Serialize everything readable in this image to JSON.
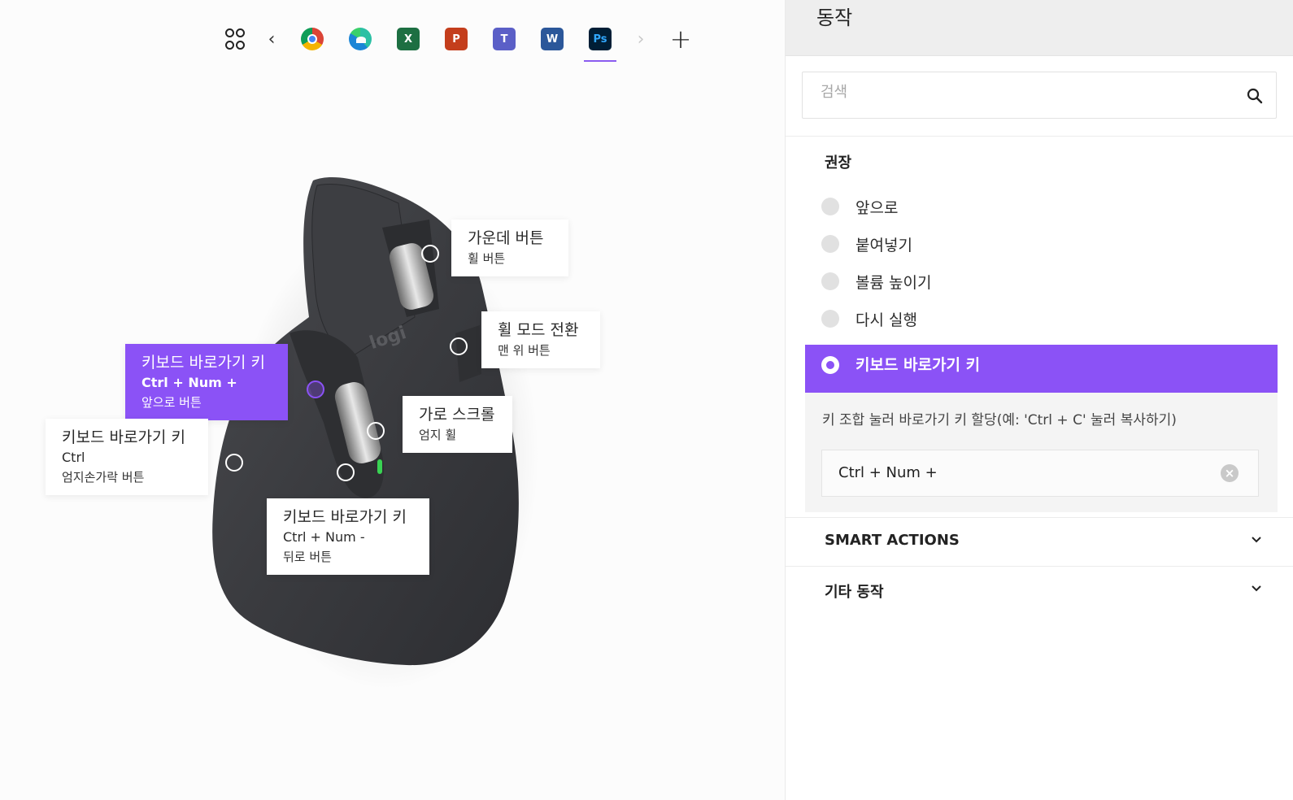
{
  "appbar": {
    "apps": [
      {
        "name": "Chrome"
      },
      {
        "name": "Edge"
      },
      {
        "name": "Excel",
        "glyph": "X",
        "color": "#1d6f42"
      },
      {
        "name": "PowerPoint",
        "glyph": "P",
        "color": "#c43e1c"
      },
      {
        "name": "Teams",
        "glyph": "T",
        "color": "#5b5fc7"
      },
      {
        "name": "Word",
        "glyph": "W",
        "color": "#2b579a"
      },
      {
        "name": "Photoshop",
        "glyph": "Ps",
        "color": "#001e36",
        "active": true
      }
    ],
    "icons": [
      "all-apps-icon",
      "chevron-left-icon",
      "chevron-right-icon",
      "plus-icon"
    ]
  },
  "callouts": {
    "middle": {
      "title": "가운데 버튼",
      "sub": "휠 버튼"
    },
    "wheelmode": {
      "title": "휠 모드 전환",
      "sub": "맨 위 버튼"
    },
    "forward": {
      "title": "키보드 바로가기 키",
      "keys": "Ctrl + Num +",
      "sub": "앞으로 버튼"
    },
    "hscroll": {
      "title": "가로 스크롤",
      "sub": "엄지 휠"
    },
    "thumb": {
      "title": "키보드 바로가기 키",
      "keys": "Ctrl",
      "sub": "엄지손가락 버튼"
    },
    "back": {
      "title": "키보드 바로가기 키",
      "keys": "Ctrl + Num -",
      "sub": "뒤로 버튼"
    }
  },
  "panel": {
    "title": "동작",
    "search_placeholder": "검색",
    "recommended_title": "권장",
    "options": [
      "앞으로",
      "붙여넣기",
      "볼륨 높이기",
      "다시 실행"
    ],
    "selected": {
      "label": "키보드 바로가기 키",
      "description": "키 조합 눌러 바로가기 키 할당(예: 'Ctrl + C' 눌러 복사하기)",
      "value": "Ctrl + Num +"
    },
    "sections": [
      "SMART ACTIONS",
      "기타 동작"
    ]
  },
  "colors": {
    "accent": "#8b52f6"
  }
}
